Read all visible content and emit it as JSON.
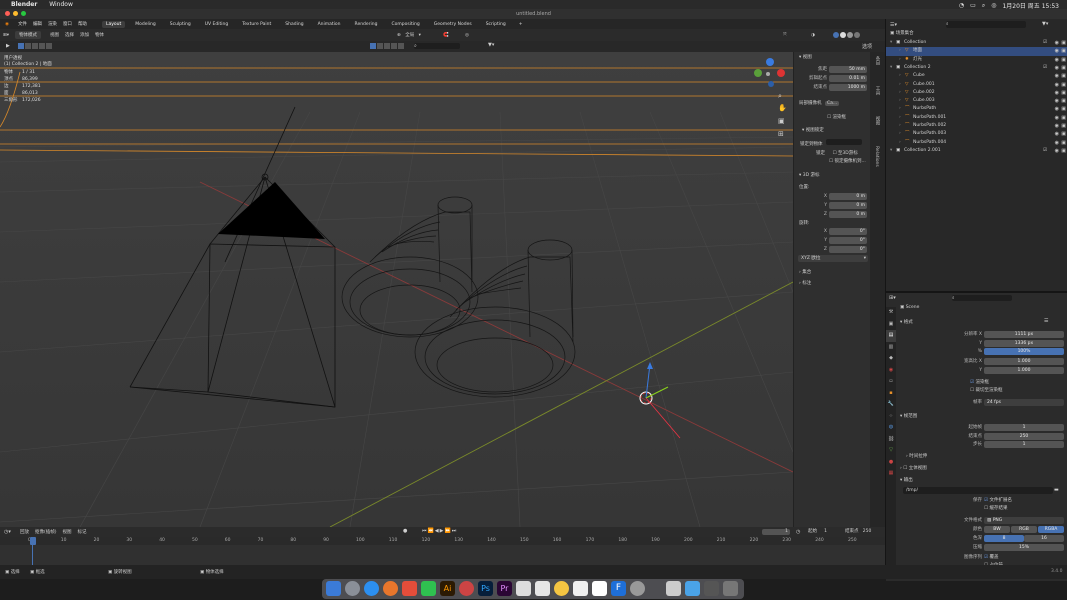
{
  "macbar": {
    "apple": "",
    "app": "Blender",
    "menu": "Window",
    "clock": "1月20日 周五 15:53"
  },
  "window": {
    "title": "untitled.blend"
  },
  "menu": {
    "items": [
      "文件",
      "编辑",
      "渲染",
      "窗口",
      "帮助"
    ],
    "workspaces": [
      "Layout",
      "Modeling",
      "Sculpting",
      "UV Editing",
      "Texture Paint",
      "Shading",
      "Animation",
      "Rendering",
      "Compositing",
      "Geometry Nodes",
      "Scripting"
    ],
    "active_workspace": "Layout",
    "add_tab": "+",
    "scene": "Scene",
    "viewlayer": "ViewLayer"
  },
  "viewport_header": {
    "mode": "物体模式",
    "items": [
      "视图",
      "选择",
      "添加",
      "物体"
    ],
    "transform": "全局",
    "select_label": "选项"
  },
  "overlay": {
    "title": "用户透视",
    "sub": "(1) Collection 2 | 地面",
    "stats": [
      {
        "k": "物体",
        "v": "1 / 31"
      },
      {
        "k": "顶点",
        "v": "86,399"
      },
      {
        "k": "边",
        "v": "172,381"
      },
      {
        "k": "面",
        "v": "86,013"
      },
      {
        "k": "三角形",
        "v": "172,026"
      }
    ]
  },
  "npanel": {
    "view_header": "视图",
    "rows": [
      {
        "k": "焦距",
        "v": "50 mm"
      },
      {
        "k": "剪辑起点",
        "v": "0.01 m"
      },
      {
        "k": "结束点",
        "v": "1000 m"
      }
    ],
    "local_camera": "局部摄像机",
    "camera_value": "Ca...",
    "render_region": "渲染框",
    "view_lock_header": "视图锁定",
    "lock_to_object": "锁定到物体",
    "lock_label": "锁定",
    "lock_3d_cursor": "至3D游标",
    "lock_camera": "锁定摄像机到...",
    "cursor_header": "3D 游标",
    "location_label": "位置:",
    "loc": [
      {
        "k": "X",
        "v": "0 m"
      },
      {
        "k": "Y",
        "v": "0 m"
      },
      {
        "k": "Z",
        "v": "0 m"
      }
    ],
    "rotation_label": "旋转:",
    "rot": [
      {
        "k": "X",
        "v": "0°"
      },
      {
        "k": "Y",
        "v": "0°"
      },
      {
        "k": "Z",
        "v": "0°"
      }
    ],
    "rotation_mode": "XYZ 欧拉",
    "collections_header": "集合",
    "annotation_header": "标注",
    "tabs": [
      "条目",
      "工具",
      "视图",
      "Relations"
    ]
  },
  "outliner": {
    "root": "场景集合",
    "rows": [
      {
        "name": "Collection",
        "depth": 0,
        "type": "col"
      },
      {
        "name": "地面",
        "depth": 1,
        "type": "mesh",
        "selected": true
      },
      {
        "name": "灯光",
        "depth": 1,
        "type": "light"
      },
      {
        "name": "Collection 2",
        "depth": 0,
        "type": "col"
      },
      {
        "name": "Cube",
        "depth": 1,
        "type": "mesh"
      },
      {
        "name": "Cube.001",
        "depth": 1,
        "type": "mesh"
      },
      {
        "name": "Cube.002",
        "depth": 1,
        "type": "mesh"
      },
      {
        "name": "Cube.003",
        "depth": 1,
        "type": "mesh"
      },
      {
        "name": "NurbsPath",
        "depth": 1,
        "type": "curve"
      },
      {
        "name": "NurbsPath.001",
        "depth": 1,
        "type": "curve"
      },
      {
        "name": "NurbsPath.002",
        "depth": 1,
        "type": "curve"
      },
      {
        "name": "NurbsPath.003",
        "depth": 1,
        "type": "curve"
      },
      {
        "name": "NurbsPath.004",
        "depth": 1,
        "type": "curve"
      },
      {
        "name": "Collection 2.001",
        "depth": 0,
        "type": "col"
      }
    ]
  },
  "props": {
    "scene": "Scene",
    "format_header": "格式",
    "res": [
      {
        "k": "分辨率 X",
        "v": "1111 px"
      },
      {
        "k": "Y",
        "v": "1336 px"
      },
      {
        "k": "%",
        "v": "100%"
      }
    ],
    "aspect": [
      {
        "k": "宽高比 X",
        "v": "1.000"
      },
      {
        "k": "Y",
        "v": "1.000"
      }
    ],
    "render_region": "渲染框",
    "crop": "裁切至渲染框",
    "fps_label": "帧率",
    "fps": "24 fps",
    "frame_range_header": "帧范围",
    "frames": [
      {
        "k": "起始帧",
        "v": "1"
      },
      {
        "k": "结束点",
        "v": "250"
      },
      {
        "k": "步长",
        "v": "1"
      }
    ],
    "time_stretch": "时间拉伸",
    "stereo": "立体视图",
    "output_header": "输出",
    "path": "/tmp/",
    "save_label": "保存",
    "file_ext": "文件扩展名",
    "cache": "缓存结果",
    "file_format_label": "文件格式",
    "file_format": "PNG",
    "color_label": "颜色",
    "bw": "BW",
    "rgb": "RGB",
    "rgba": "RGBA",
    "depth_label": "色深",
    "depth8": "8",
    "depth16": "16",
    "compress_label": "压缩",
    "compress": "15%",
    "seq_label": "图像序列",
    "overwrite": "覆盖",
    "placeholder": "占位符"
  },
  "timeline": {
    "items": [
      "回放",
      "抠像(插帧)",
      "视图",
      "标记"
    ],
    "current": "1",
    "start_label": "起始",
    "start": "1",
    "end_label": "结束点",
    "end": "250",
    "ticks": [
      "0",
      "10",
      "20",
      "30",
      "40",
      "50",
      "60",
      "70",
      "80",
      "90",
      "100",
      "110",
      "120",
      "130",
      "140",
      "150",
      "160",
      "170",
      "180",
      "190",
      "200",
      "210",
      "220",
      "230",
      "240",
      "250"
    ]
  },
  "statusbar": {
    "s1": "选择",
    "s2": "框选",
    "s3": "旋转视图",
    "s4": "物体选择",
    "version": "3.4.0"
  }
}
